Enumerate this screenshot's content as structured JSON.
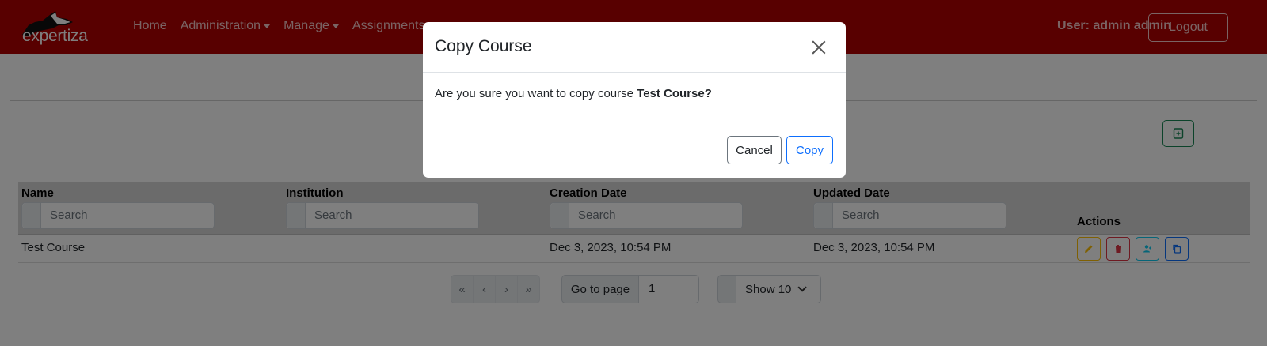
{
  "navbar": {
    "logo_text": "expertiza",
    "links": [
      {
        "label": "Home",
        "dropdown": false
      },
      {
        "label": "Administration",
        "dropdown": true
      },
      {
        "label": "Manage",
        "dropdown": true
      },
      {
        "label": "Assignments",
        "dropdown": false
      }
    ],
    "user_label": "User: admin admin",
    "logout_label": "Logout",
    "brand_color": "#b10000"
  },
  "table": {
    "columns": [
      {
        "header": "Name",
        "search_placeholder": "Search"
      },
      {
        "header": "Institution",
        "search_placeholder": "Search"
      },
      {
        "header": "Creation Date",
        "search_placeholder": "Search"
      },
      {
        "header": "Updated Date",
        "search_placeholder": "Search"
      }
    ],
    "actions_header": "Actions",
    "rows": [
      {
        "name": "Test Course",
        "institution": "",
        "created": "Dec 3, 2023, 10:54 PM",
        "updated": "Dec 3, 2023, 10:54 PM"
      }
    ],
    "action_icons": [
      "edit-icon",
      "delete-icon",
      "assign-ta-icon",
      "copy-icon"
    ]
  },
  "pagination": {
    "buttons": [
      "«",
      "‹",
      "›",
      "»"
    ],
    "goto_label": "Go to page",
    "page_value": "1",
    "show_label": "Show 10"
  },
  "modal": {
    "title": "Copy Course",
    "body_prefix": "Are you sure you want to copy course ",
    "body_bold": "Test Course?",
    "cancel_label": "Cancel",
    "copy_label": "Copy"
  }
}
